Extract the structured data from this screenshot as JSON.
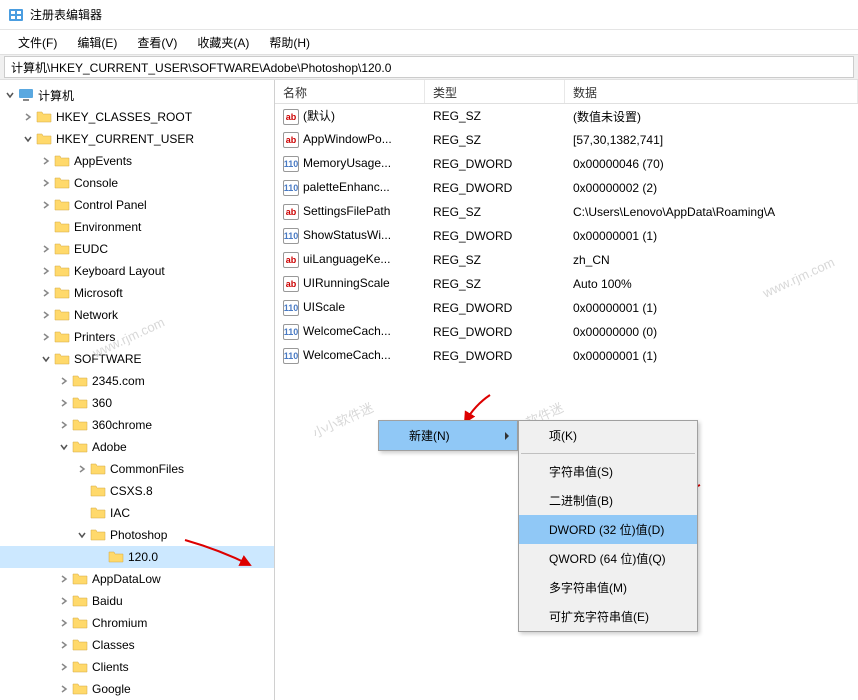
{
  "window": {
    "title": "注册表编辑器"
  },
  "menu": {
    "file": "文件(F)",
    "edit": "编辑(E)",
    "view": "查看(V)",
    "favorites": "收藏夹(A)",
    "help": "帮助(H)"
  },
  "address": "计算机\\HKEY_CURRENT_USER\\SOFTWARE\\Adobe\\Photoshop\\120.0",
  "tree": {
    "root": "计算机",
    "hkcr": "HKEY_CLASSES_ROOT",
    "hkcu": "HKEY_CURRENT_USER",
    "children": {
      "appevents": "AppEvents",
      "console": "Console",
      "controlpanel": "Control Panel",
      "environment": "Environment",
      "eudc": "EUDC",
      "keyboard": "Keyboard Layout",
      "microsoft": "Microsoft",
      "network": "Network",
      "printers": "Printers",
      "software": "SOFTWARE",
      "sw": {
        "2345": "2345.com",
        "360": "360",
        "360chrome": "360chrome",
        "adobe": "Adobe",
        "adobe_children": {
          "commonfiles": "CommonFiles",
          "csxs": "CSXS.8",
          "iac": "IAC",
          "photoshop": "Photoshop",
          "ps_version": "120.0"
        },
        "appdatalow": "AppDataLow",
        "baidu": "Baidu",
        "chromium": "Chromium",
        "classes": "Classes",
        "clients": "Clients",
        "google": "Google"
      }
    }
  },
  "list": {
    "col_name": "名称",
    "col_type": "类型",
    "col_data": "数据",
    "rows": [
      {
        "name": "(默认)",
        "type": "REG_SZ",
        "data": "(数值未设置)",
        "icon": "sz"
      },
      {
        "name": "AppWindowPo...",
        "type": "REG_SZ",
        "data": "[57,30,1382,741]",
        "icon": "sz"
      },
      {
        "name": "MemoryUsage...",
        "type": "REG_DWORD",
        "data": "0x00000046 (70)",
        "icon": "dw"
      },
      {
        "name": "paletteEnhanc...",
        "type": "REG_DWORD",
        "data": "0x00000002 (2)",
        "icon": "dw"
      },
      {
        "name": "SettingsFilePath",
        "type": "REG_SZ",
        "data": "C:\\Users\\Lenovo\\AppData\\Roaming\\A",
        "icon": "sz"
      },
      {
        "name": "ShowStatusWi...",
        "type": "REG_DWORD",
        "data": "0x00000001 (1)",
        "icon": "dw"
      },
      {
        "name": "uiLanguageKe...",
        "type": "REG_SZ",
        "data": "zh_CN",
        "icon": "sz"
      },
      {
        "name": "UIRunningScale",
        "type": "REG_SZ",
        "data": "Auto 100%",
        "icon": "sz"
      },
      {
        "name": "UIScale",
        "type": "REG_DWORD",
        "data": "0x00000001 (1)",
        "icon": "dw"
      },
      {
        "name": "WelcomeCach...",
        "type": "REG_DWORD",
        "data": "0x00000000 (0)",
        "icon": "dw"
      },
      {
        "name": "WelcomeCach...",
        "type": "REG_DWORD",
        "data": "0x00000001 (1)",
        "icon": "dw"
      }
    ]
  },
  "context_menu": {
    "new": "新建(N)",
    "submenu": {
      "key": "项(K)",
      "string": "字符串值(S)",
      "binary": "二进制值(B)",
      "dword": "DWORD (32 位)值(D)",
      "qword": "QWORD (64 位)值(Q)",
      "multi": "多字符串值(M)",
      "expand": "可扩充字符串值(E)"
    }
  },
  "watermarks": [
    "www.rjm.com",
    "小小软件迷",
    "www.rjm.com",
    "小小软件迷"
  ]
}
